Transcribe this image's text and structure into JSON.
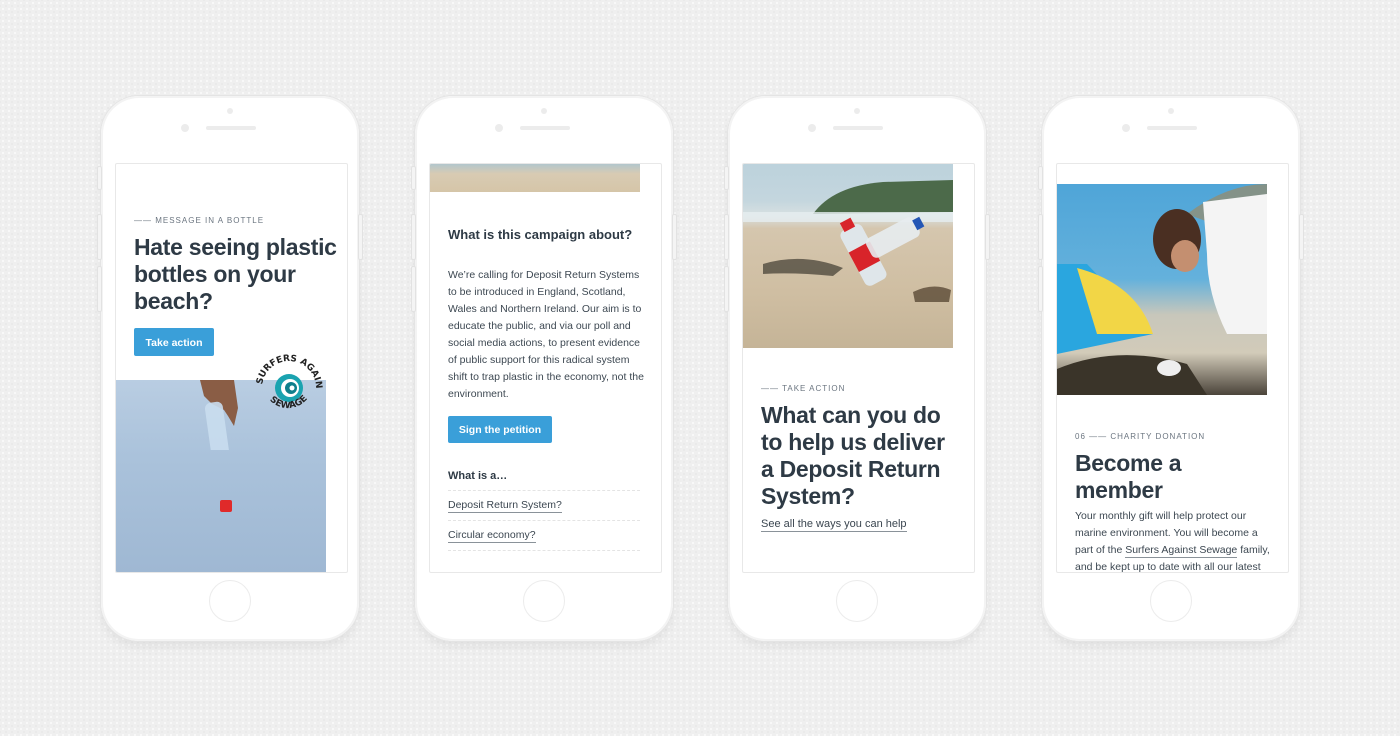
{
  "phones": [
    {
      "eyebrow": "—— MESSAGE IN A BOTTLE",
      "title": "Hate seeing plastic bottles on your beach?",
      "button_label": "Take action",
      "logo": {
        "top_text": "SURFERS",
        "right_text": "AGAINST",
        "bottom_text": "SEWAGE"
      },
      "image_alt": "hand holding plastic bottle against sky"
    },
    {
      "image_alt": "beach sand strip",
      "heading": "What is this campaign about?",
      "body": "We’re calling for Deposit Return Systems to be introduced in England, Scotland, Wales and Northern Ireland. Our aim is to educate the public, and via our poll and social media actions, to present evidence of public support for this radical system shift to trap plastic in the economy, not the environment.",
      "button_label": "Sign the petition",
      "subheading": "What is a…",
      "questions": [
        "Deposit Return System?",
        "Circular economy?"
      ]
    },
    {
      "image_alt": "plastic bottles on beach",
      "eyebrow": "—— TAKE ACTION",
      "title": "What can you do to help us deliver a Deposit Return System?",
      "link_label": "See all the ways you can help"
    },
    {
      "image_alt": "volunteer cleaning beach",
      "eyebrow": "06 —— CHARITY DONATION",
      "title": "Become a member",
      "body_before": "Your monthly gift will help protect our marine environment. You will become a part of the ",
      "body_link": "Surfers Against Sewage",
      "body_after": " family, and be kept up to date with all our latest"
    }
  ],
  "colors": {
    "accent": "#3a9fd9",
    "text": "#2e3a45",
    "logo_teal": "#1aa3b0"
  }
}
